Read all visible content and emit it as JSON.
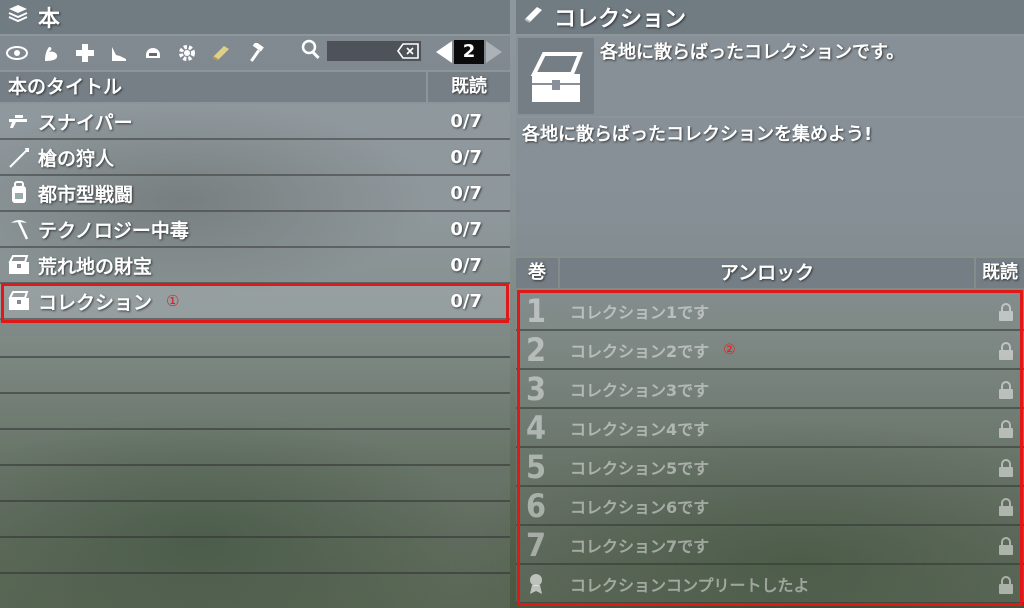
{
  "left_panel": {
    "title": "本",
    "toolbar_icons": [
      "eye-icon",
      "muscle-icon",
      "cross-icon",
      "shoe-icon",
      "helmet-icon",
      "gear-icon",
      "book-icon",
      "hammer-icon"
    ],
    "page_number": "2",
    "column_title": "本のタイトル",
    "column_read": "既読",
    "rows": [
      {
        "icon": "rifle-icon",
        "title": "スナイパー",
        "count": "0/7"
      },
      {
        "icon": "spear-icon",
        "title": "槍の狩人",
        "count": "0/7"
      },
      {
        "icon": "backpack-icon",
        "title": "都市型戦闘",
        "count": "0/7"
      },
      {
        "icon": "pickaxe-icon",
        "title": "テクノロジー中毒",
        "count": "0/7"
      },
      {
        "icon": "chest-icon",
        "title": "荒れ地の財宝",
        "count": "0/7"
      },
      {
        "icon": "chest-icon",
        "title": "コレクション",
        "count": "0/7",
        "marker": "①"
      }
    ]
  },
  "right_panel": {
    "title": "コレクション",
    "short_description": "各地に散らばったコレクションです。",
    "long_description": "各地に散らばったコレクションを集めよう!",
    "column_volume": "巻",
    "column_unlock": "アンロック",
    "column_read": "既読",
    "items": [
      {
        "volume": "1",
        "text": "コレクション1です"
      },
      {
        "volume": "2",
        "text": "コレクション2です",
        "marker": "②"
      },
      {
        "volume": "3",
        "text": "コレクション3です"
      },
      {
        "volume": "4",
        "text": "コレクション4です"
      },
      {
        "volume": "5",
        "text": "コレクション5です"
      },
      {
        "volume": "6",
        "text": "コレクション6です"
      },
      {
        "volume": "7",
        "text": "コレクション7です"
      },
      {
        "volume": "",
        "text": "コレクションコンプリートしたよ"
      }
    ]
  },
  "colors": {
    "highlight": "#e01818",
    "marker": "#e02020"
  }
}
